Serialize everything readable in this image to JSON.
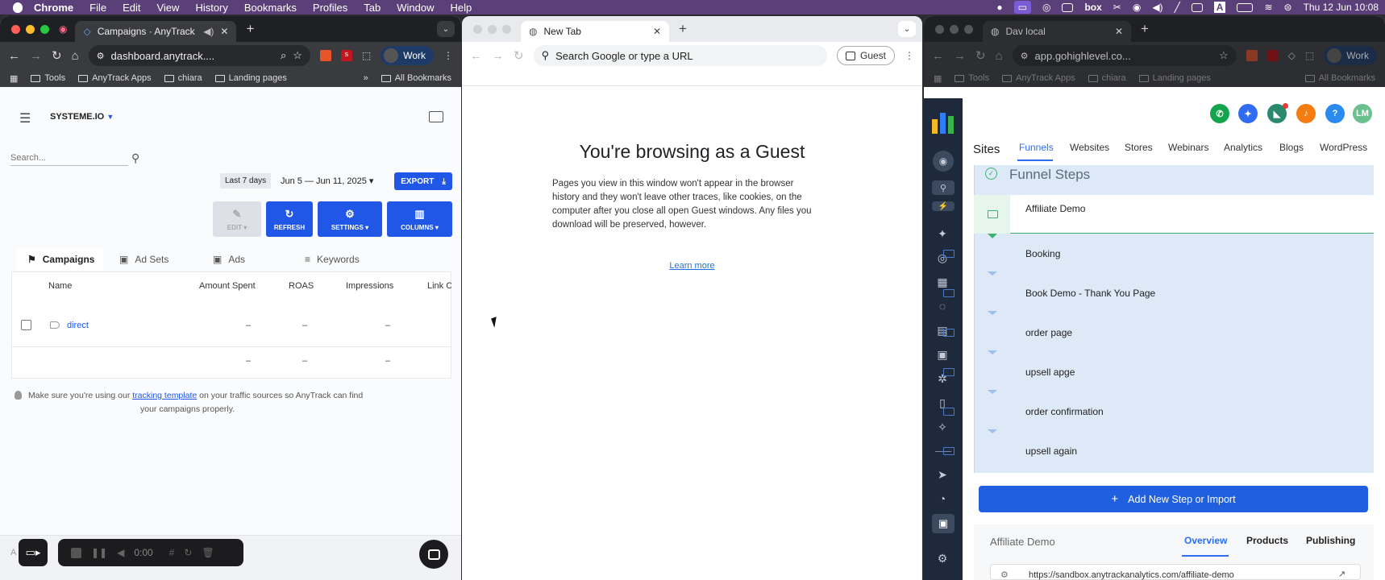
{
  "menubar": {
    "apple": "",
    "app": "Chrome",
    "items": [
      "File",
      "Edit",
      "View",
      "History",
      "Bookmarks",
      "Profiles",
      "Tab",
      "Window",
      "Help"
    ],
    "box": "box",
    "datetime": "Thu 12 Jun  10:08"
  },
  "win1": {
    "tab_title": "Campaigns · AnyTrack",
    "url": "dashboard.anytrack....",
    "profile": "Work",
    "bookmarks": [
      "Tools",
      "AnyTrack Apps",
      "chiara",
      "Landing pages"
    ],
    "all_bookmarks": "All Bookmarks",
    "workspace": "SYSTEME.IO",
    "search_placeholder": "Search...",
    "range_label": "Last 7 days",
    "date_range": "Jun 5 — Jun 11, 2025",
    "export": "EXPORT",
    "buttons": {
      "edit": "EDIT",
      "refresh": "REFRESH",
      "settings": "SETTINGS",
      "columns": "COLUMNS"
    },
    "tabs": [
      "Campaigns",
      "Ad Sets",
      "Ads",
      "Keywords"
    ],
    "columns": [
      "Name",
      "Amount Spent",
      "ROAS",
      "Impressions",
      "Link C"
    ],
    "row": {
      "name": "direct",
      "amount": "–",
      "roas": "–",
      "impressions": "–"
    },
    "totals": {
      "amount": "–",
      "roas": "–",
      "impressions": "–"
    },
    "tip_before": "Make sure you're using our ",
    "tip_link": "tracking template",
    "tip_after": " on your traffic sources so AnyTrack can find",
    "tip_line2": "your campaigns properly.",
    "recorder_time": "0:00",
    "footer_text": "A"
  },
  "win2": {
    "tab_title": "New Tab",
    "omnibox": "Search Google or type a URL",
    "guest": "Guest",
    "heading": "You're browsing as a Guest",
    "para": [
      "Pages you view in this window won't appear in the browser",
      "history and they won't leave other traces, like cookies, on the",
      "computer after you close all open Guest windows. Any files you",
      "download will be preserved, however."
    ],
    "learn_more": "Learn more"
  },
  "win3": {
    "tab_title": "Dav local",
    "url": "app.gohighlevel.co...",
    "profile": "Work",
    "bookmarks": [
      "Tools",
      "AnyTrack Apps",
      "chiara",
      "Landing pages"
    ],
    "all_bookmarks": "All Bookmarks",
    "avatar": "LM",
    "help": "?",
    "nav": [
      "Sites",
      "Funnels",
      "Websites",
      "Stores",
      "Webinars",
      "Analytics",
      "Blogs",
      "WordPress"
    ],
    "section": "Funnel Steps",
    "steps": [
      "Affiliate Demo",
      "Booking",
      "Book Demo - Thank You Page",
      "order page",
      "upsell apge",
      "order confirmation",
      "upsell again"
    ],
    "add_step": "Add New Step or Import",
    "detail_title": "Affiliate Demo",
    "detail_tabs": [
      "Overview",
      "Products",
      "Publishing"
    ],
    "detail_url": "https://sandbox.anytrackanalytics.com/affiliate-demo"
  },
  "colors": {
    "accent_blue": "#2157e6",
    "ghl_blue": "#1f5fe0",
    "menubar": "#5a3f78"
  }
}
